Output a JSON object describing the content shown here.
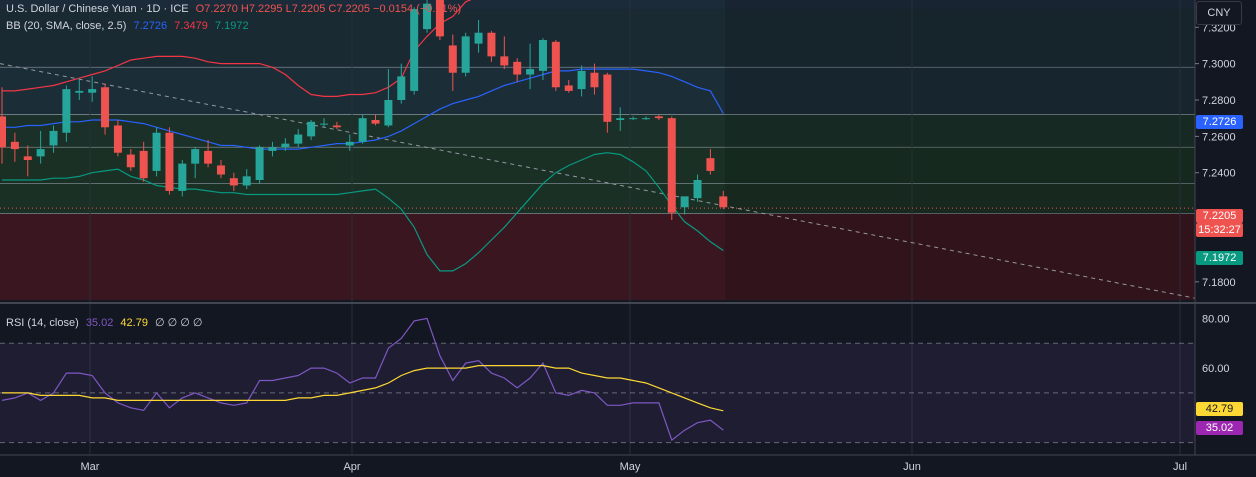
{
  "header": {
    "symbol": "U.S. Dollar / Chinese Yuan · 1D · ICE",
    "ohlc": "O7.2270  H7.2295  L7.2205  C7.2205  −0.0154 (−0.21%)",
    "bb_title": "BB (20, SMA, close, 2.5)",
    "bb_basis": "7.2726",
    "bb_upper": "7.3479",
    "bb_lower": "7.1972",
    "rsi_title": "RSI (14, close)",
    "rsi_value": "35.02",
    "rsi_ma": "42.79",
    "rsi_extra": "∅ ∅ ∅ ∅"
  },
  "currency": "CNY",
  "price_scale": {
    "ticks": [
      "7.3200",
      "7.3000",
      "7.2800",
      "7.2600",
      "7.2400",
      "7.1800"
    ],
    "last_price": "7.2205",
    "countdown": "15:32:27",
    "bb_basis_tag": "7.2726",
    "bb_lower_tag": "7.1972"
  },
  "rsi_scale": {
    "ticks": [
      "80.00",
      "60.00"
    ],
    "ma_tag": "42.79",
    "rsi_tag": "35.02"
  },
  "time_axis": [
    "Mar",
    "Apr",
    "May",
    "Jun",
    "Jul"
  ],
  "colors": {
    "up": "#26a69a",
    "down": "#ef5350",
    "basis": "#2962ff",
    "upper": "#f23645",
    "lower": "#089981",
    "rsi": "#7e57c2",
    "rsi_ma": "#fdd835",
    "background": "#131722"
  },
  "chart_data": {
    "type": "candlestick",
    "price_range": [
      7.17,
      7.335
    ],
    "rsi_range": [
      25,
      85
    ],
    "candles": [
      {
        "o": 7.271,
        "h": 7.287,
        "l": 7.245,
        "c": 7.254
      },
      {
        "o": 7.257,
        "h": 7.262,
        "l": 7.246,
        "c": 7.253
      },
      {
        "o": 7.249,
        "h": 7.255,
        "l": 7.238,
        "c": 7.247
      },
      {
        "o": 7.249,
        "h": 7.263,
        "l": 7.245,
        "c": 7.253
      },
      {
        "o": 7.255,
        "h": 7.266,
        "l": 7.251,
        "c": 7.263
      },
      {
        "o": 7.262,
        "h": 7.288,
        "l": 7.257,
        "c": 7.286
      },
      {
        "o": 7.284,
        "h": 7.292,
        "l": 7.28,
        "c": 7.285
      },
      {
        "o": 7.284,
        "h": 7.293,
        "l": 7.279,
        "c": 7.286
      },
      {
        "o": 7.287,
        "h": 7.289,
        "l": 7.261,
        "c": 7.265
      },
      {
        "o": 7.266,
        "h": 7.269,
        "l": 7.249,
        "c": 7.251
      },
      {
        "o": 7.25,
        "h": 7.253,
        "l": 7.241,
        "c": 7.243
      },
      {
        "o": 7.252,
        "h": 7.257,
        "l": 7.235,
        "c": 7.237
      },
      {
        "o": 7.241,
        "h": 7.265,
        "l": 7.238,
        "c": 7.262
      },
      {
        "o": 7.262,
        "h": 7.265,
        "l": 7.228,
        "c": 7.23
      },
      {
        "o": 7.23,
        "h": 7.247,
        "l": 7.227,
        "c": 7.245
      },
      {
        "o": 7.245,
        "h": 7.254,
        "l": 7.237,
        "c": 7.253
      },
      {
        "o": 7.252,
        "h": 7.258,
        "l": 7.243,
        "c": 7.245
      },
      {
        "o": 7.244,
        "h": 7.247,
        "l": 7.237,
        "c": 7.239
      },
      {
        "o": 7.237,
        "h": 7.24,
        "l": 7.23,
        "c": 7.233
      },
      {
        "o": 7.233,
        "h": 7.242,
        "l": 7.231,
        "c": 7.238
      },
      {
        "o": 7.236,
        "h": 7.255,
        "l": 7.234,
        "c": 7.254
      },
      {
        "o": 7.252,
        "h": 7.257,
        "l": 7.249,
        "c": 7.254
      },
      {
        "o": 7.254,
        "h": 7.259,
        "l": 7.252,
        "c": 7.256
      },
      {
        "o": 7.256,
        "h": 7.264,
        "l": 7.254,
        "c": 7.261
      },
      {
        "o": 7.26,
        "h": 7.269,
        "l": 7.258,
        "c": 7.268
      },
      {
        "o": 7.267,
        "h": 7.27,
        "l": 7.265,
        "c": 7.267
      },
      {
        "o": 7.266,
        "h": 7.268,
        "l": 7.264,
        "c": 7.265
      },
      {
        "o": 7.255,
        "h": 7.261,
        "l": 7.252,
        "c": 7.257
      },
      {
        "o": 7.257,
        "h": 7.272,
        "l": 7.256,
        "c": 7.27
      },
      {
        "o": 7.269,
        "h": 7.272,
        "l": 7.266,
        "c": 7.267
      },
      {
        "o": 7.266,
        "h": 7.297,
        "l": 7.265,
        "c": 7.28
      },
      {
        "o": 7.28,
        "h": 7.3,
        "l": 7.278,
        "c": 7.293
      },
      {
        "o": 7.285,
        "h": 7.331,
        "l": 7.283,
        "c": 7.33
      },
      {
        "o": 7.319,
        "h": 7.341,
        "l": 7.317,
        "c": 7.333
      },
      {
        "o": 7.338,
        "h": 7.34,
        "l": 7.313,
        "c": 7.315
      },
      {
        "o": 7.31,
        "h": 7.316,
        "l": 7.285,
        "c": 7.295
      },
      {
        "o": 7.295,
        "h": 7.317,
        "l": 7.293,
        "c": 7.315
      },
      {
        "o": 7.311,
        "h": 7.324,
        "l": 7.306,
        "c": 7.317
      },
      {
        "o": 7.317,
        "h": 7.318,
        "l": 7.301,
        "c": 7.304
      },
      {
        "o": 7.304,
        "h": 7.315,
        "l": 7.297,
        "c": 7.299
      },
      {
        "o": 7.301,
        "h": 7.303,
        "l": 7.29,
        "c": 7.294
      },
      {
        "o": 7.294,
        "h": 7.311,
        "l": 7.286,
        "c": 7.297
      },
      {
        "o": 7.296,
        "h": 7.314,
        "l": 7.291,
        "c": 7.313
      },
      {
        "o": 7.312,
        "h": 7.313,
        "l": 7.285,
        "c": 7.287
      },
      {
        "o": 7.288,
        "h": 7.291,
        "l": 7.284,
        "c": 7.285
      },
      {
        "o": 7.286,
        "h": 7.299,
        "l": 7.282,
        "c": 7.296
      },
      {
        "o": 7.295,
        "h": 7.3,
        "l": 7.283,
        "c": 7.287
      },
      {
        "o": 7.294,
        "h": 7.295,
        "l": 7.262,
        "c": 7.268
      },
      {
        "o": 7.269,
        "h": 7.276,
        "l": 7.263,
        "c": 7.27
      },
      {
        "o": 7.27,
        "h": 7.271,
        "l": 7.269,
        "c": 7.27
      },
      {
        "o": 7.27,
        "h": 7.271,
        "l": 7.269,
        "c": 7.27
      },
      {
        "o": 7.271,
        "h": 7.272,
        "l": 7.269,
        "c": 7.27
      },
      {
        "o": 7.27,
        "h": 7.271,
        "l": 7.214,
        "c": 7.218
      },
      {
        "o": 7.221,
        "h": 7.226,
        "l": 7.217,
        "c": 7.227
      },
      {
        "o": 7.226,
        "h": 7.239,
        "l": 7.224,
        "c": 7.236
      },
      {
        "o": 7.248,
        "h": 7.253,
        "l": 7.239,
        "c": 7.241
      },
      {
        "o": 7.227,
        "h": 7.23,
        "l": 7.22,
        "c": 7.221
      }
    ],
    "bb_upper": [
      7.285,
      7.285,
      7.286,
      7.287,
      7.288,
      7.29,
      7.292,
      7.294,
      7.296,
      7.299,
      7.302,
      7.303,
      7.304,
      7.304,
      7.304,
      7.303,
      7.301,
      7.3,
      7.3,
      7.3,
      7.3,
      7.298,
      7.294,
      7.288,
      7.283,
      7.282,
      7.282,
      7.283,
      7.283,
      7.284,
      7.287,
      7.292,
      7.307,
      7.315,
      7.322,
      7.326,
      7.334,
      7.337,
      7.34,
      7.34,
      7.342,
      7.342,
      7.342,
      7.342,
      7.342,
      7.343,
      7.342,
      7.342,
      7.342,
      7.342,
      7.342,
      7.342,
      7.342,
      7.342,
      7.342,
      7.342,
      7.342
    ],
    "bb_basis": [
      7.265,
      7.265,
      7.266,
      7.266,
      7.267,
      7.268,
      7.268,
      7.269,
      7.269,
      7.269,
      7.268,
      7.267,
      7.265,
      7.263,
      7.261,
      7.259,
      7.257,
      7.255,
      7.255,
      7.254,
      7.253,
      7.253,
      7.253,
      7.253,
      7.254,
      7.255,
      7.256,
      7.256,
      7.257,
      7.258,
      7.26,
      7.263,
      7.267,
      7.271,
      7.275,
      7.278,
      7.28,
      7.282,
      7.285,
      7.288,
      7.29,
      7.292,
      7.294,
      7.296,
      7.296,
      7.297,
      7.297,
      7.297,
      7.297,
      7.297,
      7.296,
      7.295,
      7.293,
      7.29,
      7.287,
      7.285,
      7.2726
    ],
    "bb_lower": [
      7.236,
      7.236,
      7.236,
      7.236,
      7.237,
      7.237,
      7.238,
      7.24,
      7.241,
      7.242,
      7.238,
      7.236,
      7.233,
      7.232,
      7.231,
      7.231,
      7.23,
      7.229,
      7.229,
      7.228,
      7.228,
      7.228,
      7.228,
      7.228,
      7.228,
      7.228,
      7.228,
      7.229,
      7.23,
      7.231,
      7.226,
      7.22,
      7.21,
      7.195,
      7.186,
      7.186,
      7.19,
      7.196,
      7.203,
      7.21,
      7.218,
      7.226,
      7.234,
      7.24,
      7.244,
      7.247,
      7.25,
      7.251,
      7.25,
      7.246,
      7.241,
      7.232,
      7.222,
      7.213,
      7.208,
      7.202,
      7.1972
    ],
    "rsi": [
      47,
      48,
      50,
      47,
      50,
      58,
      58,
      57,
      50,
      46,
      44,
      43,
      50,
      44,
      48,
      50,
      48,
      46,
      45,
      46,
      55,
      55,
      56,
      57,
      60,
      60,
      58,
      54,
      56,
      56,
      68,
      72,
      79,
      80,
      65,
      55,
      62,
      63,
      58,
      56,
      52,
      56,
      62,
      50,
      49,
      51,
      50,
      45,
      45,
      46,
      46,
      46,
      31,
      35,
      38,
      39,
      35.02
    ],
    "rsi_ma": [
      50,
      50,
      50,
      49,
      49,
      49,
      49,
      48,
      48,
      47,
      47,
      47,
      47,
      47,
      47,
      47,
      47,
      47,
      47,
      47,
      47,
      47,
      47,
      48,
      48,
      49,
      49,
      50,
      51,
      52,
      54,
      57,
      59,
      60,
      60,
      60,
      60,
      61,
      61,
      61,
      61,
      61,
      61,
      60,
      60,
      58,
      57,
      56,
      56,
      55,
      54,
      52,
      50,
      48,
      46,
      44,
      42.79
    ],
    "annotations": {
      "last_price": 7.2205,
      "dashed_trendline": "descending"
    }
  }
}
